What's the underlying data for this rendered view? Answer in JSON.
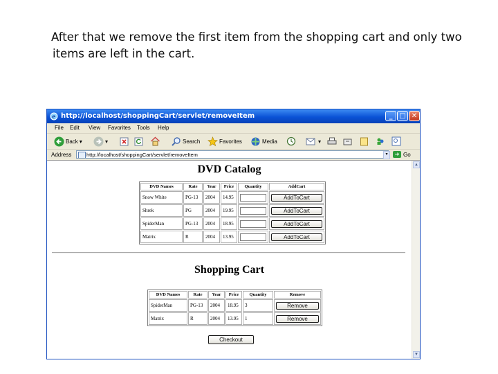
{
  "caption": {
    "line1": "After that we remove the first item from the shopping cart and only two",
    "line2": "items are left in the cart."
  },
  "window": {
    "title": "http://localhost/shoppingCart/servlet/removeItem",
    "menu": [
      "File",
      "Edit",
      "View",
      "Favorites",
      "Tools",
      "Help"
    ],
    "toolbar": {
      "back": "Back",
      "search": "Search",
      "favorites": "Favorites",
      "media": "Media"
    },
    "address_label": "Address",
    "address_value": "http://localhost/shoppingCart/servlet/removeItem",
    "go_label": "Go"
  },
  "catalog": {
    "title": "DVD Catalog",
    "headers": [
      "DVD Names",
      "Rate",
      "Year",
      "Price",
      "Quantity",
      "AddCart"
    ],
    "rows": [
      {
        "name": "Snow White",
        "rate": "PG-13",
        "year": "2004",
        "price": "14.95",
        "button": "AddToCart"
      },
      {
        "name": "Shrek",
        "rate": "PG",
        "year": "2004",
        "price": "19.95",
        "button": "AddToCart"
      },
      {
        "name": "SpiderMan",
        "rate": "PG-13",
        "year": "2004",
        "price": "18.95",
        "button": "AddToCart"
      },
      {
        "name": "Matrix",
        "rate": "R",
        "year": "2004",
        "price": "13.95",
        "button": "AddToCart"
      }
    ]
  },
  "cart": {
    "title": "Shopping Cart",
    "headers": [
      "DVD Names",
      "Rate",
      "Year",
      "Price",
      "Quantity",
      "Remove"
    ],
    "rows": [
      {
        "name": "SpiderMan",
        "rate": "PG-13",
        "year": "2004",
        "price": "18.95",
        "quantity": "3",
        "button": "Remove"
      },
      {
        "name": "Matrix",
        "rate": "R",
        "year": "2004",
        "price": "13.95",
        "quantity": "1",
        "button": "Remove"
      }
    ],
    "checkout_label": "Checkout"
  }
}
